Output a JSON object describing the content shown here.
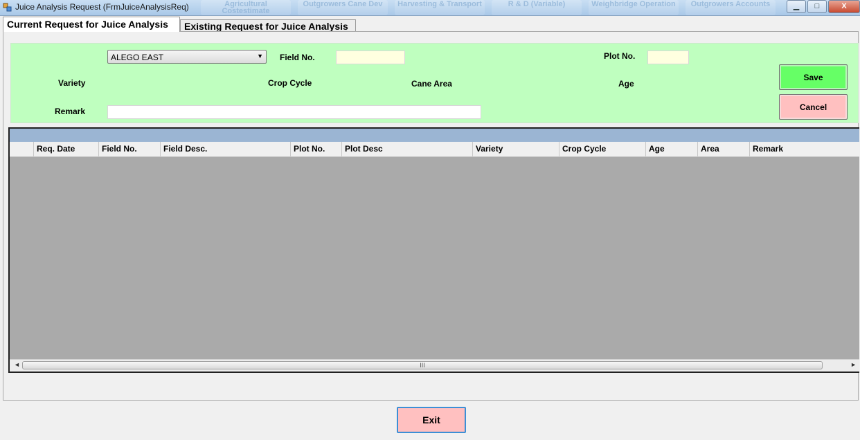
{
  "window": {
    "title": "Juice Analysis Request (FrmJuiceAnalysisReq)",
    "background_tabs": [
      "Agricultural Costestimate",
      "Outgrowers Cane Dev",
      "Harvesting & Transport",
      "R & D (Variable)",
      "Weighbridge Operation",
      "Outgrowers Accounts"
    ],
    "controls": {
      "minimize": "▁",
      "maximize": "□",
      "close": "X"
    }
  },
  "tabs": [
    {
      "label": "Current Request for Juice Analysis",
      "active": true
    },
    {
      "label": "Existing Request for Juice Analysis",
      "active": false
    }
  ],
  "form": {
    "zone_select": {
      "value": "ALEGO EAST",
      "arrow": "▼"
    },
    "field_no_label": "Field No.",
    "field_no_value": "",
    "plot_no_label": "Plot No.",
    "plot_no_value": "",
    "variety_label": "Variety",
    "crop_cycle_label": "Crop Cycle",
    "cane_area_label": "Cane Area",
    "age_label": "Age",
    "remark_label": "Remark",
    "remark_value": ""
  },
  "buttons": {
    "save": "Save",
    "cancel": "Cancel",
    "exit": "Exit"
  },
  "grid": {
    "columns": [
      "Req. Date",
      "Field No.",
      "Field Desc.",
      "Plot No.",
      "Plot Desc",
      "Variety",
      "Crop Cycle",
      "Age",
      "Area",
      "Remark"
    ],
    "rows": [],
    "scroll_left": "◄",
    "scroll_right": "►",
    "scroll_grip": "III"
  },
  "colors": {
    "form_background": "#bfffbf",
    "save_button": "#66ff66",
    "cancel_button": "#ffc0c0",
    "grid_empty": "#aaaaaa",
    "grid_caption": "#9bb5d3"
  }
}
